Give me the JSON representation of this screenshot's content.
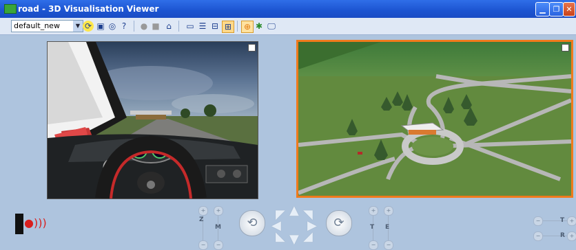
{
  "window": {
    "title": "road - 3D Visualisation Viewer"
  },
  "toolbar": {
    "view_select": "default_new",
    "icons": [
      "refresh-icon",
      "save-icon",
      "database-icon",
      "help-icon",
      "record-icon",
      "stop-icon",
      "home-icon",
      "layout-single-icon",
      "layout-horizontal-icon",
      "layout-quad-icon",
      "layout-grid-icon",
      "target-icon",
      "satellite-icon",
      "display-icon"
    ]
  },
  "controls": {
    "zoom_label": "Z",
    "m_label": "M",
    "t_label": "T",
    "e_label": "E",
    "tr_label": "T",
    "r_label": "R"
  }
}
